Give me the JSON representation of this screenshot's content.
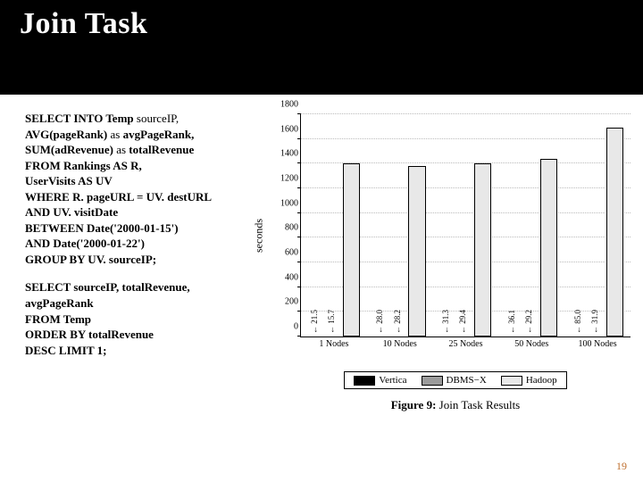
{
  "title": "Join Task",
  "sql1": {
    "l1a": "SELECT INTO Temp ",
    "l1b": "sourceIP, ",
    "l2a": "AVG(pageRank) ",
    "l2b": "as ",
    "l2c": "avgPageRank, ",
    "l3a": "SUM(adRevenue) ",
    "l3b": "as ",
    "l3c": "totalRevenue",
    "l4a": "FROM Rankings AS R, ",
    "l5a": "UserVisits AS UV",
    "l6a": "WHERE R. pageURL = UV. destURL",
    "l7a": "AND UV. visitDate",
    "l8a": "BETWEEN Date('2000-01-15')",
    "l9a": "AND Date('2000-01-22')",
    "l10a": "GROUP BY UV. sourceIP;"
  },
  "sql2": {
    "l1": "SELECT sourceIP, totalRevenue,",
    "l2": " avgPageRank",
    "l3": "FROM Temp",
    "l4": "ORDER BY totalRevenue",
    "l5": "DESC LIMIT 1;"
  },
  "legend": {
    "a": "Vertica",
    "b": "DBMS−X",
    "c": "Hadoop"
  },
  "ylabel": "seconds",
  "caption_figno": "Figure 9:",
  "caption_text": " Join Task Results",
  "yticks": [
    "0",
    "200",
    "400",
    "600",
    "800",
    "1000",
    "1200",
    "1400",
    "1600",
    "1800"
  ],
  "pagenum": "19",
  "chart_data": {
    "type": "bar",
    "ylabel": "seconds",
    "ylim": [
      0,
      1800
    ],
    "categories": [
      "1 Nodes",
      "10 Nodes",
      "25 Nodes",
      "50 Nodes",
      "100 Nodes"
    ],
    "series": [
      {
        "name": "Vertica",
        "values": [
          null,
          null,
          null,
          null,
          null
        ],
        "labels": [
          "21.5",
          "28.0",
          "31.3",
          "36.1",
          "85.0"
        ]
      },
      {
        "name": "DBMS−X",
        "values": [
          null,
          null,
          null,
          null,
          null
        ],
        "labels": [
          "15.7",
          "28.2",
          "29.4",
          "29.2",
          "31.9"
        ]
      },
      {
        "name": "Hadoop",
        "values": [
          1400,
          1380,
          1400,
          1440,
          1690
        ]
      }
    ],
    "title": "Figure 9: Join Task Results"
  }
}
